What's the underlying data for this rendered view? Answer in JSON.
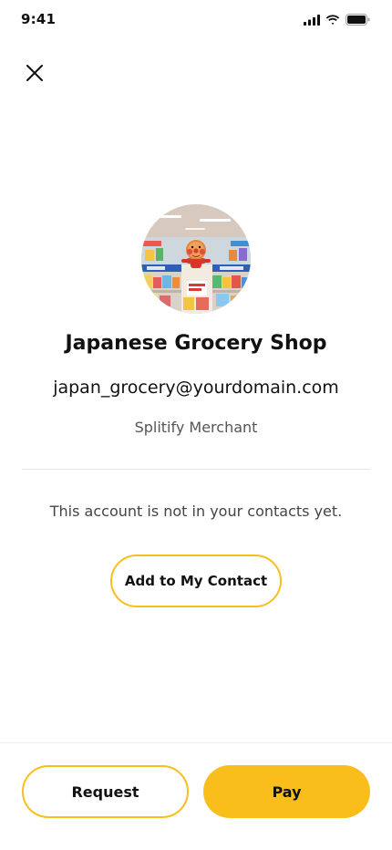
{
  "status_bar": {
    "time": "9:41"
  },
  "header": {
    "close_icon": "close-icon"
  },
  "merchant": {
    "name": "Japanese Grocery Shop",
    "email": "japan_grocery@yourdomain.com",
    "type": "Splitify Merchant",
    "avatar_icon": "store-photo"
  },
  "contact": {
    "note": "This account is not in your contacts yet.",
    "add_label": "Add to My Contact"
  },
  "actions": {
    "request_label": "Request",
    "pay_label": "Pay"
  },
  "colors": {
    "accent": "#F9BE1C",
    "text": "#111111",
    "muted": "#555555",
    "divider": "#E6E6E6"
  }
}
